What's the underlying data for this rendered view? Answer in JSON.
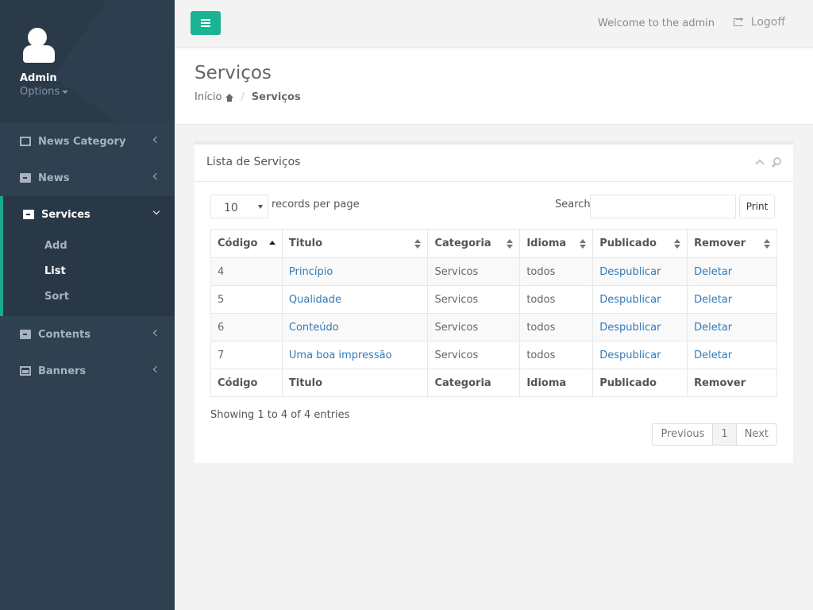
{
  "profile": {
    "name": "Admin",
    "options_label": "Options"
  },
  "sidebar": {
    "items": [
      {
        "label": "News Category",
        "icon": "documents-icon"
      },
      {
        "label": "News",
        "icon": "archive-icon"
      },
      {
        "label": "Services",
        "icon": "archive-icon",
        "active": true,
        "children": [
          {
            "label": "Add"
          },
          {
            "label": "List",
            "current": true
          },
          {
            "label": "Sort"
          }
        ]
      },
      {
        "label": "Contents",
        "icon": "archive-icon"
      },
      {
        "label": "Banners",
        "icon": "image-icon"
      }
    ]
  },
  "topbar": {
    "welcome": "Welcome to the admin",
    "logoff": "Logoff"
  },
  "heading": {
    "title": "Serviços",
    "breadcrumb_home": "Início",
    "breadcrumb_current": "Serviços"
  },
  "panel": {
    "title": "Lista de Serviços",
    "length_value": "10",
    "length_label": "records per page",
    "search_label": "Search:",
    "search_value": "",
    "print_label": "Print",
    "columns": [
      "Código",
      "Titulo",
      "Categoria",
      "Idioma",
      "Publicado",
      "Remover"
    ],
    "rows": [
      [
        "4",
        "Princípio",
        "Servicos",
        "todos",
        "Despublicar",
        "Deletar"
      ],
      [
        "5",
        "Qualidade",
        "Servicos",
        "todos",
        "Despublicar",
        "Deletar"
      ],
      [
        "6",
        "Conteúdo",
        "Servicos",
        "todos",
        "Despublicar",
        "Deletar"
      ],
      [
        "7",
        "Uma boa impressão",
        "Servicos",
        "todos",
        "Despublicar",
        "Deletar"
      ]
    ],
    "info": "Showing 1 to 4 of 4 entries",
    "pager": {
      "previous": "Previous",
      "page": "1",
      "next": "Next"
    }
  },
  "colors": {
    "sidebar": "#2f4050",
    "accent": "#1ab394",
    "link": "#337ab7"
  }
}
